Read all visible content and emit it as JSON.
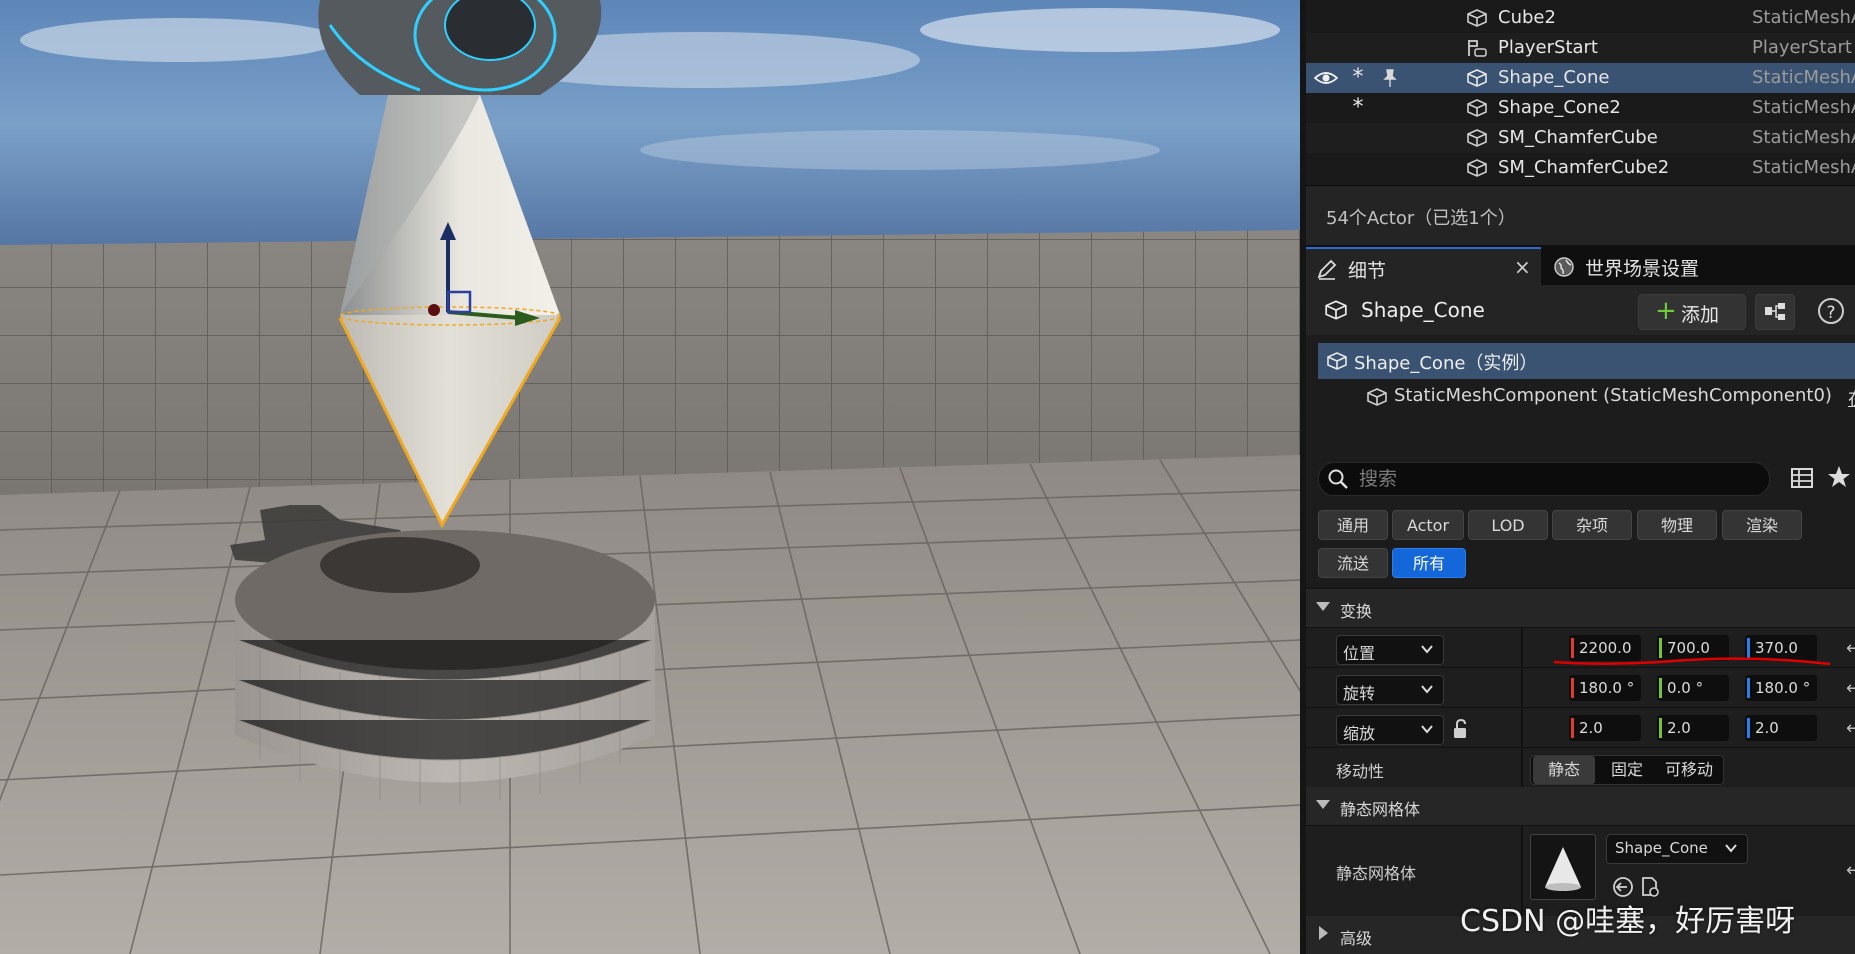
{
  "outliner": {
    "rows": [
      {
        "name": "Cube2",
        "type": "StaticMeshA"
      },
      {
        "name": "PlayerStart",
        "type": "PlayerStart"
      },
      {
        "name": "Shape_Cone",
        "type": "StaticMeshA"
      },
      {
        "name": "Shape_Cone2",
        "type": "StaticMeshA"
      },
      {
        "name": "SM_ChamferCube",
        "type": "StaticMeshA"
      },
      {
        "name": "SM_ChamferCube2",
        "type": "StaticMeshA"
      }
    ],
    "star": "*",
    "footer": "54个Actor（已选1个）"
  },
  "tabs": {
    "details": "细节",
    "close": "×",
    "world": "世界场景设置"
  },
  "details": {
    "actor_name": "Shape_Cone",
    "add_label": "添加",
    "add_plus": "+",
    "help": "?",
    "instance_label": "Shape_Cone（实例）",
    "component_label": "StaticMeshComponent (StaticMeshComponent0)",
    "component_ext": "在"
  },
  "search": {
    "placeholder": "搜索"
  },
  "categories": [
    "通用",
    "Actor",
    "LOD",
    "杂项",
    "物理",
    "渲染",
    "流送",
    "所有"
  ],
  "transform": {
    "section": "变换",
    "location": {
      "label": "位置",
      "x": "2200.0",
      "y": "700.0",
      "z": "370.0"
    },
    "rotation": {
      "label": "旋转",
      "x": "180.0 °",
      "y": "0.0 °",
      "z": "180.0 °"
    },
    "scale": {
      "label": "缩放",
      "x": "2.0",
      "y": "2.0",
      "z": "2.0"
    },
    "mobility": {
      "label": "移动性",
      "options": [
        "静态",
        "固定",
        "可移动"
      ]
    }
  },
  "static_mesh": {
    "section": "静态网格体",
    "label": "静态网格体",
    "value": "Shape_Cone"
  },
  "advanced": {
    "section": "高级"
  },
  "reset_arrow": "←",
  "watermark": "CSDN @哇塞，好厉害呀",
  "colors": {
    "selection": "#3a5372",
    "accent_blue": "#1467d8",
    "axis_x": "#e03a2e",
    "axis_y": "#7cc13a",
    "axis_z": "#2f7ee8",
    "annotation_red": "#e00000"
  }
}
